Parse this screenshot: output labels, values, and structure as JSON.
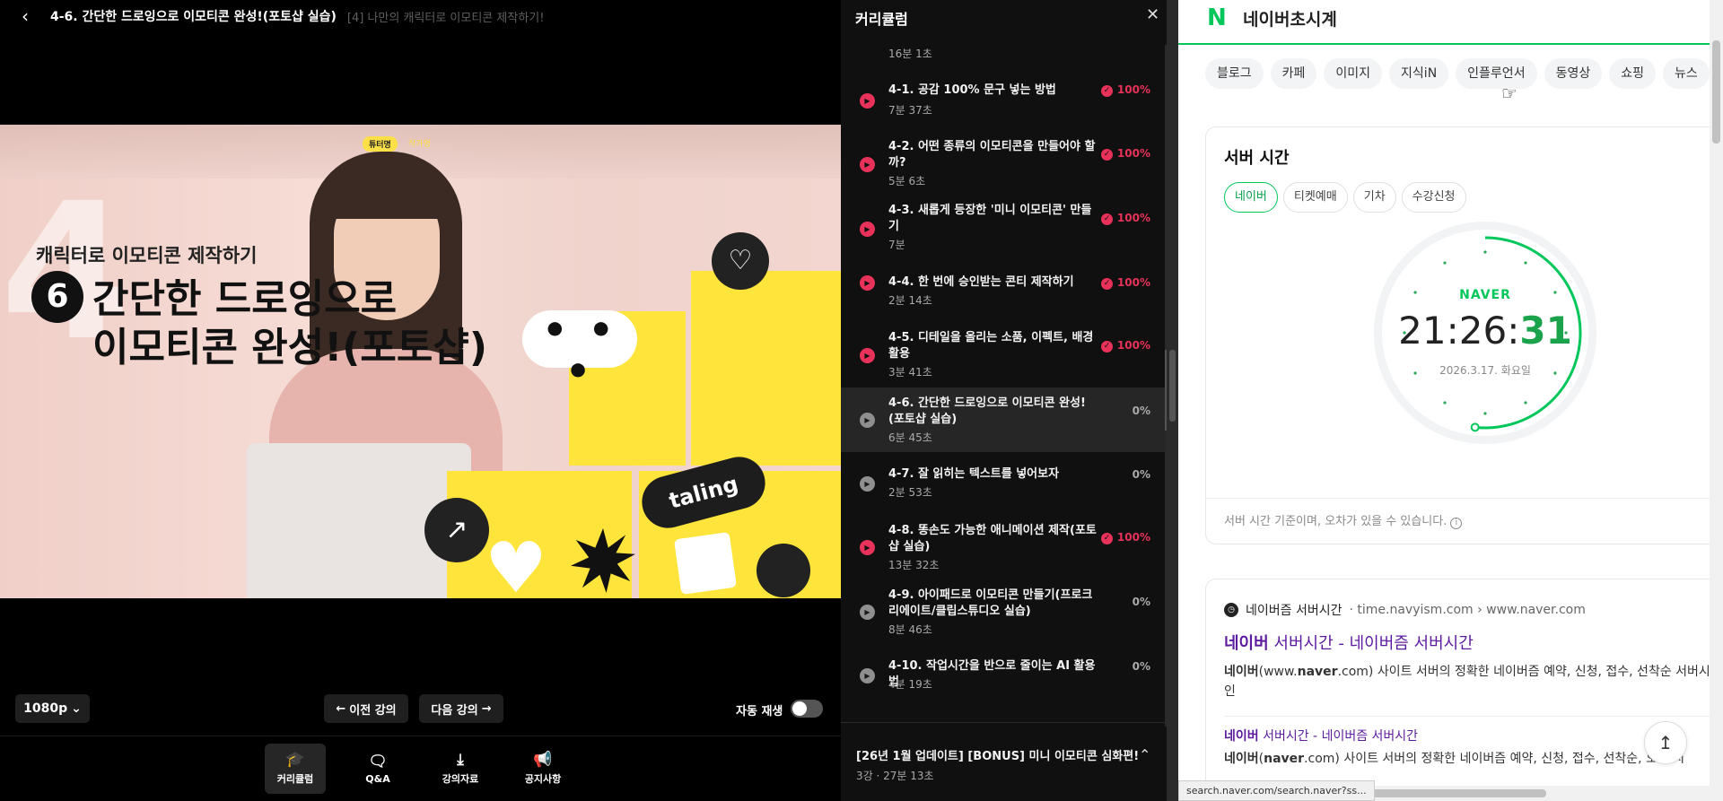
{
  "player": {
    "lesson_title": "4-6. 간단한 드로잉으로 이모티콘 완성!(포토샵 실습)",
    "section_title": "[4] 나만의 캐릭터로 이모티콘 제작하기!",
    "video": {
      "big_number": "4",
      "tutor_badge": "튜터명",
      "tutor_name": "작가명",
      "subtitle": "캐릭터로 이모티콘 제작하기",
      "step_number": "6",
      "headline_1": "간단한 드로잉으로",
      "headline_2": "이모티콘 완성!(포토샵)",
      "bubble_text": "• • •",
      "brand": "taling"
    },
    "quality": "1080p",
    "prev_label": "이전 강의",
    "next_label": "다음 강의",
    "autoplay_label": "자동 재생",
    "autoplay_on": false,
    "tabs": [
      {
        "label": "커리큘럼",
        "icon": "graduation-cap-icon",
        "active": true
      },
      {
        "label": "Q&A",
        "icon": "chat-icon",
        "active": false
      },
      {
        "label": "강의자료",
        "icon": "download-icon",
        "active": false
      },
      {
        "label": "공지사항",
        "icon": "megaphone-icon",
        "active": false
      }
    ]
  },
  "curriculum": {
    "title": "커리큘럼",
    "top_meta": "16분 1초",
    "lessons": [
      {
        "title": "4-1. 공감 100% 문구 넣는 방법",
        "duration": "7분 37초",
        "progress": "100%",
        "done": true
      },
      {
        "title": "4-2. 어떤 종류의 이모티콘을 만들어야 할까?",
        "duration": "5분 6초",
        "progress": "100%",
        "done": true
      },
      {
        "title": "4-3. 새롭게 등장한 '미니 이모티콘' 만들기",
        "duration": "7분",
        "progress": "100%",
        "done": true
      },
      {
        "title": "4-4. 한 번에 승인받는 콘티 제작하기",
        "duration": "2분 14초",
        "progress": "100%",
        "done": true
      },
      {
        "title": "4-5. 디테일을 올리는 소품, 이펙트, 배경 활용",
        "duration": "3분 41초",
        "progress": "100%",
        "done": true
      },
      {
        "title": "4-6. 간단한 드로잉으로 이모티콘 완성!(포토샵 실습)",
        "duration": "6분 45초",
        "progress": "0%",
        "done": false
      },
      {
        "title": "4-7. 잘 읽히는 텍스트를 넣어보자",
        "duration": "2분 53초",
        "progress": "0%",
        "done": false
      },
      {
        "title": "4-8. 똥손도 가능한 애니메이션 제작(포토샵 실습)",
        "duration": "13분 32초",
        "progress": "100%",
        "done": true
      },
      {
        "title": "4-9. 아이패드로 이모티콘 만들기(프로크리에이트/클립스튜디오 실습)",
        "duration": "8분 46초",
        "progress": "0%",
        "done": false
      },
      {
        "title": "4-10. 작업시간을 반으로 줄이는 AI 활용법",
        "duration": "4분 19초",
        "progress": "0%",
        "done": false
      }
    ],
    "next_section": {
      "title": "[26년 1월 업데이트] [BONUS] 미니 이모티콘 심화편!",
      "meta": "3강 · 27분 13초"
    }
  },
  "browser": {
    "query": "네이버초시계",
    "chips": [
      "블로그",
      "카페",
      "이미지",
      "지식iN",
      "인플루언서",
      "동영상",
      "쇼핑",
      "뉴스"
    ],
    "server_time": {
      "title": "서버 시간",
      "tabs": [
        "네이버",
        "티켓예매",
        "기차",
        "수강신청"
      ],
      "brand": "NAVER",
      "hhmm": "21:26:",
      "seconds": "31",
      "date": "2026.3.17. 화요일",
      "seconds_fraction": 0.517,
      "note": "서버 시간 기준이며, 오차가 있을 수 있습니다."
    },
    "result": {
      "site_name": "네이버즘 서버시간",
      "site_url": "· time.navyism.com › www.naver.com",
      "link_bold": "네이버",
      "link_rest": " 서버시간 - 네이버즘 서버시간",
      "desc_pre": "네이버",
      "desc_mid": "(www.",
      "desc_bold": "naver",
      "desc_post": ".com) 사이트 서버의 정확한 네이버즘 예약, 신청, 접수, 선착순 서버시간 확인",
      "sub_bold": "네이버",
      "sub_rest": " 서버시간 - 네이버즘 서버시간",
      "desc2_pre": "네이버",
      "desc2_mid": "(",
      "desc2_bold": "naver",
      "desc2_post": ".com) 사이트 서버의 정확한 네이버즘 예약, 신청, 접수, 선착순, 오픈 시"
    },
    "status_url": "search.naver.com/search.naver?ss...",
    "colors": {
      "naver_green": "#03c75a",
      "accent_red": "#e8325a",
      "visited_link": "#5c1b9e"
    }
  }
}
